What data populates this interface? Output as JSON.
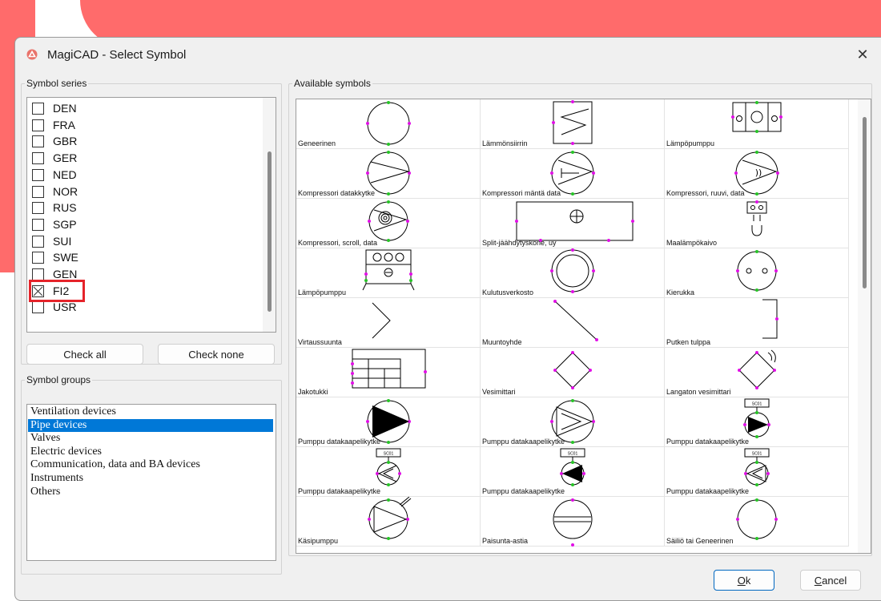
{
  "window": {
    "title": "MagiCAD - Select Symbol",
    "close_glyph": "✕",
    "app_icon": "magicad-logo-icon",
    "colors": {
      "backdrop": "#ff6b6b",
      "highlight": "#e5232a",
      "selection": "#0078d7",
      "symbol_dot_magenta": "#e10fe6",
      "symbol_dot_green": "#27c427"
    }
  },
  "symbol_series": {
    "legend": "Symbol series",
    "items": [
      {
        "label": "DEN",
        "checked": false
      },
      {
        "label": "FRA",
        "checked": false
      },
      {
        "label": "GBR",
        "checked": false
      },
      {
        "label": "GER",
        "checked": false
      },
      {
        "label": "NED",
        "checked": false
      },
      {
        "label": "NOR",
        "checked": false
      },
      {
        "label": "RUS",
        "checked": false
      },
      {
        "label": "SGP",
        "checked": false
      },
      {
        "label": "SUI",
        "checked": false
      },
      {
        "label": "SWE",
        "checked": false
      },
      {
        "label": "GEN",
        "checked": false
      },
      {
        "label": "FI2",
        "checked": true
      },
      {
        "label": "USR",
        "checked": false
      }
    ],
    "check_all": "Check all",
    "check_none": "Check none"
  },
  "symbol_groups": {
    "legend": "Symbol groups",
    "items": [
      {
        "label": "Ventilation devices",
        "selected": false
      },
      {
        "label": "Pipe devices",
        "selected": true
      },
      {
        "label": "Valves",
        "selected": false
      },
      {
        "label": "Electric devices",
        "selected": false
      },
      {
        "label": "Communication, data and BA devices",
        "selected": false
      },
      {
        "label": "Instruments",
        "selected": false
      },
      {
        "label": "Others",
        "selected": false
      }
    ]
  },
  "available_symbols": {
    "legend": "Available symbols",
    "items": [
      {
        "label": "Geneerinen",
        "icon": "circle-symbol-icon"
      },
      {
        "label": "Lämmönsiirrin",
        "icon": "heat-exchanger-icon"
      },
      {
        "label": "Lämpöpumppu",
        "icon": "heat-pump-box-icon"
      },
      {
        "label": "Kompressori datakkytke",
        "icon": "compressor-icon"
      },
      {
        "label": "Kompressori mäntä data",
        "icon": "piston-compressor-icon"
      },
      {
        "label": "Kompressori, ruuvi, data",
        "icon": "screw-compressor-icon"
      },
      {
        "label": "Kompressori, scroll, data",
        "icon": "scroll-compressor-icon"
      },
      {
        "label": "Split-jäähdytyskone, uy",
        "icon": "split-cooler-icon"
      },
      {
        "label": "Maalämpökaivo",
        "icon": "ground-well-icon"
      },
      {
        "label": "Lämpöpumppu",
        "icon": "heat-pump-unit-icon"
      },
      {
        "label": "Kulutusverkosto",
        "icon": "double-circle-icon"
      },
      {
        "label": "Kierukka",
        "icon": "coil-icon"
      },
      {
        "label": "Virtaussuunta",
        "icon": "flow-direction-icon"
      },
      {
        "label": "Muuntoyhde",
        "icon": "adapter-line-icon"
      },
      {
        "label": "Putken tulppa",
        "icon": "pipe-cap-icon"
      },
      {
        "label": "Jakotukki",
        "icon": "manifold-icon"
      },
      {
        "label": "Vesimittari",
        "icon": "water-meter-icon"
      },
      {
        "label": "Langaton vesimittari",
        "icon": "wireless-water-meter-icon"
      },
      {
        "label": "Pumppu datakaapelikytke",
        "icon": "pump-filled-icon"
      },
      {
        "label": "Pumppu datakaapelikytke",
        "icon": "pump-double-arrow-icon"
      },
      {
        "label": "Pumppu datakaapelikytke",
        "icon": "pump-tagged-icon"
      },
      {
        "label": "Pumppu datakaapelikytke",
        "icon": "pump-tagged-small-icon"
      },
      {
        "label": "Pumppu datakaapelikytke",
        "icon": "pump-tagged-filled-left-icon"
      },
      {
        "label": "Pumppu datakaapelikytke",
        "icon": "pump-tagged-double-left-icon"
      },
      {
        "label": "Käsipumppu",
        "icon": "hand-pump-icon"
      },
      {
        "label": "Paisunta-astia",
        "icon": "expansion-tank-icon"
      },
      {
        "label": "Säiliö tai Geneerinen",
        "icon": "tank-circle-icon"
      }
    ],
    "tag_text": "SC01"
  },
  "footer": {
    "ok_prefix": "",
    "ok_underlined": "O",
    "ok_rest": "k",
    "cancel_underlined": "C",
    "cancel_rest": "ancel"
  }
}
